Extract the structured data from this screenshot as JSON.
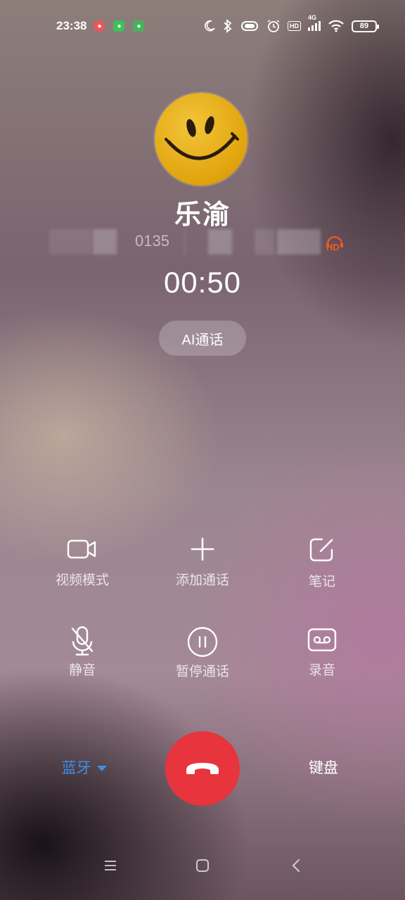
{
  "status_bar": {
    "time": "23:38",
    "battery": "89",
    "network": "4G",
    "hd_label": "HD",
    "icons": [
      "notification-icon",
      "wechat-icon",
      "android-icon",
      "moon-icon",
      "bluetooth-icon",
      "vibrate-icon",
      "alarm-icon",
      "hd-icon",
      "signal-icon",
      "wifi-icon",
      "battery-icon"
    ]
  },
  "call": {
    "contact_name": "乐渝",
    "phone_number_visible": "0135",
    "hd_voice_label": "HD",
    "timer": "00:50",
    "ai_call_label": "AI通话"
  },
  "controls": [
    {
      "label": "视频模式",
      "icon": "video-camera-icon"
    },
    {
      "label": "添加通话",
      "icon": "plus-icon"
    },
    {
      "label": "笔记",
      "icon": "note-edit-icon"
    },
    {
      "label": "静音",
      "icon": "mic-mute-icon"
    },
    {
      "label": "暂停通话",
      "icon": "pause-icon"
    },
    {
      "label": "录音",
      "icon": "record-icon"
    }
  ],
  "bottom": {
    "bluetooth_label": "蓝牙",
    "keypad_label": "键盘"
  },
  "colors": {
    "end_call": "#e8343d",
    "bluetooth_accent": "#3d8ee8",
    "hd_accent": "#f05a1e"
  }
}
